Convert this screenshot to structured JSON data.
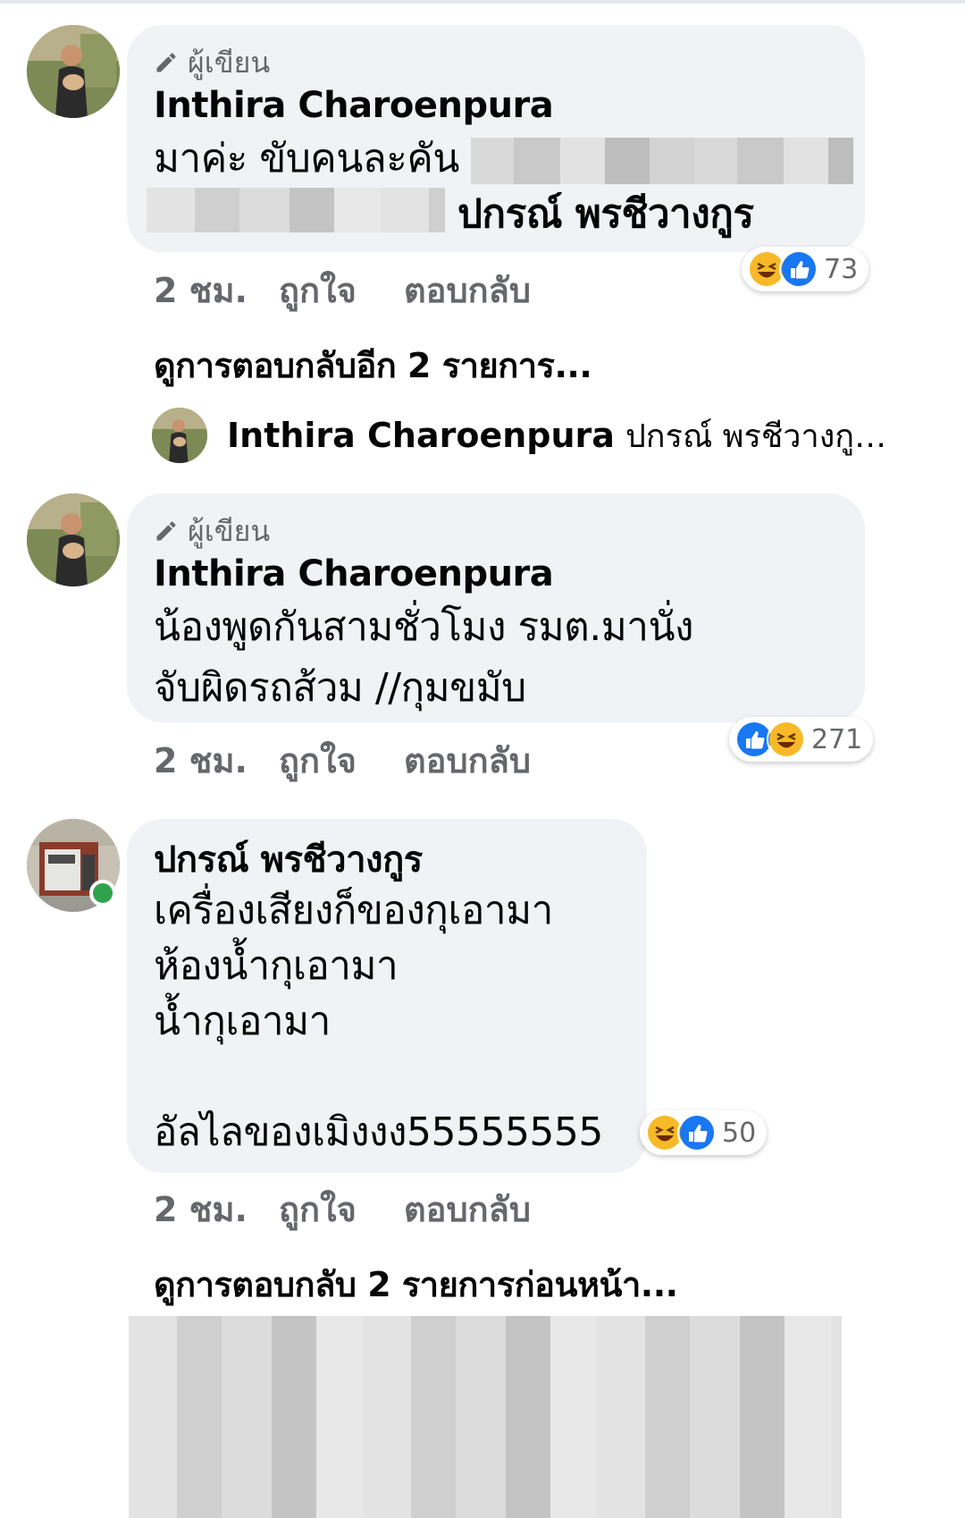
{
  "comments": [
    {
      "author_badge": "ผู้เขียน",
      "name": "Inthira Charoenpura",
      "line1": "มาค่ะ ขับคนละคัน",
      "line2_tag": "ปกรณ์ พรชีวางกูร",
      "time": "2 ชม.",
      "like_label": "ถูกใจ",
      "reply_label": "ตอบกลับ",
      "reaction_count": "73",
      "reaction_icons": [
        "haha-icon",
        "like-icon"
      ]
    },
    {
      "author_badge": "ผู้เขียน",
      "name": "Inthira Charoenpura",
      "line1": "น้องพูดกันสามชั่วโมง รมต.มานั่ง",
      "line2": "จับผิดรถส้วม //กุมขมับ",
      "time": "2 ชม.",
      "like_label": "ถูกใจ",
      "reply_label": "ตอบกลับ",
      "reaction_count": "271",
      "reaction_icons": [
        "like-icon",
        "haha-icon"
      ]
    },
    {
      "name": "ปกรณ์ พรชีวางกูร",
      "lines": [
        "เครื่องเสียงก็ของกุเอามา",
        "ห้องน้ำกุเอามา",
        "น้ำกุเอามา",
        "",
        "อัลไลของเมิงงง55555555"
      ],
      "time": "2 ชม.",
      "like_label": "ถูกใจ",
      "reply_label": "ตอบกลับ",
      "reaction_count": "50",
      "reaction_icons": [
        "haha-icon",
        "like-icon"
      ],
      "online": true
    }
  ],
  "view_more_replies": "ดูการตอบกลับอีก 2 รายการ...",
  "reply_preview": {
    "name": "Inthira Charoenpura",
    "text": "ปกรณ์ พรชีวางกู…"
  },
  "view_previous_replies": "ดูการตอบกลับ 2 รายการก่อนหน้า...",
  "colors": {
    "bubble": "#f0f2f5",
    "meta_text": "#65676b",
    "like_blue": "#1877f2",
    "haha_yellow": "#f7b928",
    "online_green": "#31a24c"
  }
}
